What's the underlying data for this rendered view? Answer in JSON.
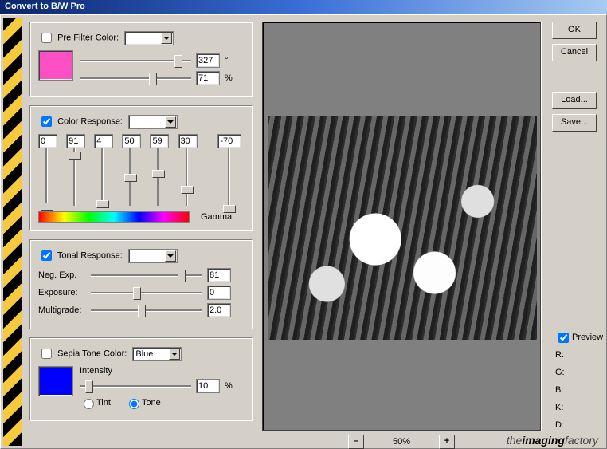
{
  "window": {
    "title": "Convert to B/W Pro"
  },
  "prefilter": {
    "label": "Pre Filter Color:",
    "checked": false,
    "combo": "",
    "swatch": "#ff4fc4",
    "hue": {
      "value": 327,
      "unit": "°",
      "pos": 0.85
    },
    "sat": {
      "value": 71,
      "unit": "%",
      "pos": 0.62
    }
  },
  "color_response": {
    "label": "Color Response:",
    "checked": true,
    "combo": "",
    "channels": [
      {
        "value": 0,
        "pos": 0.95
      },
      {
        "value": 91,
        "pos": 0.05
      },
      {
        "value": 4,
        "pos": 0.9
      },
      {
        "value": 50,
        "pos": 0.45
      },
      {
        "value": 59,
        "pos": 0.38
      },
      {
        "value": 30,
        "pos": 0.65
      }
    ],
    "gamma": {
      "label": "Gamma",
      "value": -70,
      "pos": 0.98
    }
  },
  "tonal_response": {
    "label": "Tonal Response:",
    "checked": true,
    "combo": "",
    "rows": [
      {
        "label": "Neg. Exp.",
        "value": 81,
        "pos": 0.78
      },
      {
        "label": "Exposure:",
        "value": 0,
        "pos": 0.38
      },
      {
        "label": "Multigrade:",
        "value": "2.0",
        "pos": 0.42
      }
    ]
  },
  "sepia": {
    "label": "Sepia Tone Color:",
    "checked": false,
    "combo": "Blue",
    "swatch": "#0000ff",
    "intensity": {
      "label": "Intensity",
      "value": 10,
      "unit": "%",
      "pos": 0.05
    },
    "mode": {
      "tint_label": "Tint",
      "tone_label": "Tone",
      "selected": "tone"
    }
  },
  "zoom": {
    "minus": "–",
    "label": "50%",
    "plus": "+"
  },
  "buttons": {
    "ok": "OK",
    "cancel": "Cancel",
    "load": "Load...",
    "save": "Save..."
  },
  "preview": {
    "checkbox_label": "Preview",
    "checked": true
  },
  "readout": {
    "r": "R:",
    "g": "G:",
    "b": "B:",
    "k": "K:",
    "d": "D:"
  },
  "brand": {
    "pre": "the",
    "mid": "imaging",
    "post": "factory"
  }
}
